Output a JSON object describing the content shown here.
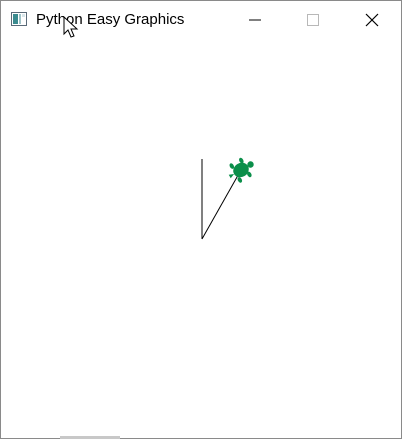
{
  "window": {
    "title": "Python Easy Graphics"
  },
  "controls": {
    "minimize": "minimize",
    "maximize": "maximize",
    "close": "close"
  },
  "colors": {
    "turtle": "#0b8f4a",
    "line": "#000000",
    "background": "#ffffff"
  },
  "icons": {
    "app": "app-window-icon",
    "cursor": "mouse-pointer-icon",
    "turtle": "turtle-icon"
  }
}
